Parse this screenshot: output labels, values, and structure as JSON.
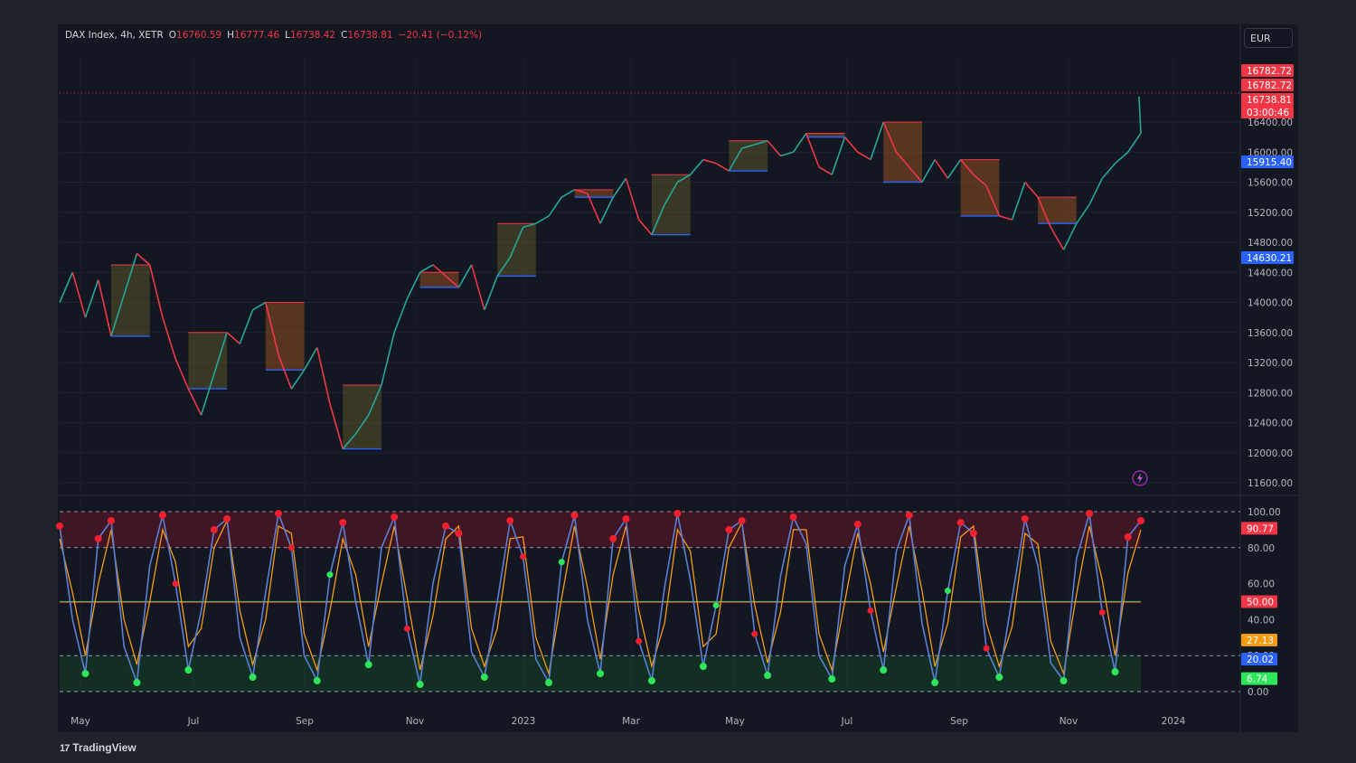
{
  "legend": {
    "symbol": "DAX Index, 4h, XETR",
    "o_label": "O",
    "o_value": "16760.59",
    "h_label": "H",
    "h_value": "16777.46",
    "l_label": "L",
    "l_value": "16738.42",
    "c_label": "C",
    "c_value": "16738.81",
    "change": "−20.41 (−0.12%)"
  },
  "currency": "EUR",
  "branding": "TradingView",
  "colors": {
    "up": "#26a69a",
    "down": "#f23645",
    "bg": "#131722",
    "stoch_k": "#5b7fd6",
    "stoch_d": "#f39c12",
    "green_dot": "#2ee65a",
    "red_dot": "#f0202f",
    "support": "#2962ff"
  },
  "chart_data": [
    {
      "type": "line",
      "name": "price",
      "x_ticks": [
        "May",
        "Jul",
        "Sep",
        "Nov",
        "2023",
        "Mar",
        "May",
        "Jul",
        "Sep",
        "Nov",
        "2024"
      ],
      "y_ticks": [
        "16400.00",
        "16000.00",
        "15600.00",
        "15200.00",
        "14800.00",
        "14400.00",
        "14000.00",
        "13600.00",
        "13200.00",
        "12800.00",
        "12400.00",
        "12000.00",
        "11600.00"
      ],
      "ylim": [
        11600,
        17200
      ],
      "x": [
        0,
        7,
        14,
        21,
        28,
        35,
        42,
        49,
        56,
        63,
        70,
        77,
        84,
        91,
        98,
        105,
        112,
        119,
        126,
        133,
        140,
        147,
        154,
        161,
        168,
        175,
        182,
        189,
        196,
        203,
        210,
        217,
        224,
        231,
        238,
        245,
        252,
        259,
        266,
        273,
        280,
        287,
        294,
        301,
        308,
        315,
        322,
        329,
        336,
        343,
        350,
        357,
        364,
        371,
        378,
        385,
        392,
        399,
        406,
        413,
        420,
        427,
        434,
        441,
        448,
        455,
        462,
        469,
        476,
        483,
        490,
        497,
        504,
        511,
        518,
        525,
        532,
        539,
        546,
        553,
        560,
        567,
        574,
        581,
        588
      ],
      "values": [
        14000,
        14400,
        13800,
        14300,
        13550,
        14100,
        14650,
        14500,
        13800,
        13250,
        12850,
        12500,
        13050,
        13600,
        13450,
        13900,
        14000,
        13300,
        12850,
        13100,
        13400,
        12650,
        12050,
        12250,
        12500,
        12900,
        13600,
        14050,
        14400,
        14500,
        14350,
        14200,
        14500,
        13900,
        14350,
        14600,
        15000,
        15050,
        15150,
        15400,
        15500,
        15450,
        15050,
        15400,
        15650,
        15100,
        14900,
        15300,
        15600,
        15700,
        15900,
        15850,
        15750,
        16050,
        16100,
        16150,
        15950,
        16000,
        16250,
        15800,
        15700,
        16200,
        16000,
        15900,
        16400,
        16000,
        15800,
        15600,
        15900,
        15650,
        15900,
        15700,
        15550,
        15150,
        15100,
        15600,
        15400,
        15000,
        14700,
        15050,
        15300,
        15650,
        15850,
        16000,
        16250
      ],
      "last_price": "16738.81",
      "countdown": "03:00:46",
      "high_tag": "16782.72",
      "high_tag_2": "16782.72",
      "resistance_tag": "15915.40",
      "support_tag": "14630.21"
    },
    {
      "type": "line",
      "name": "oscillator",
      "y_ticks": [
        "100.00",
        "80.00",
        "60.00",
        "40.00",
        "20.00",
        "0.00"
      ],
      "ylim": [
        0,
        100
      ],
      "overbought": 80,
      "oversold": 20,
      "midline": 50,
      "tags": [
        "90.77",
        "50.00",
        "27.13",
        "20.02",
        "6.74"
      ],
      "k_values": [
        92,
        40,
        10,
        85,
        95,
        25,
        5,
        70,
        98,
        60,
        12,
        45,
        90,
        96,
        30,
        8,
        55,
        99,
        80,
        20,
        6,
        65,
        94,
        50,
        15,
        80,
        97,
        35,
        4,
        60,
        92,
        88,
        22,
        8,
        50,
        95,
        75,
        18,
        5,
        72,
        98,
        40,
        10,
        85,
        96,
        28,
        6,
        58,
        99,
        62,
        14,
        48,
        90,
        95,
        32,
        9,
        64,
        97,
        82,
        20,
        7,
        70,
        93,
        45,
        12,
        78,
        98,
        38,
        5,
        56,
        94,
        88,
        24,
        8,
        52,
        96,
        70,
        16,
        6,
        74,
        99,
        44,
        11,
        86,
        95
      ],
      "d_values": [
        85,
        55,
        20,
        60,
        90,
        40,
        15,
        50,
        90,
        72,
        25,
        35,
        80,
        95,
        45,
        15,
        40,
        92,
        88,
        32,
        12,
        45,
        85,
        65,
        25,
        60,
        92,
        52,
        12,
        42,
        85,
        92,
        35,
        14,
        35,
        85,
        86,
        30,
        10,
        52,
        92,
        58,
        18,
        65,
        92,
        45,
        14,
        38,
        90,
        78,
        25,
        32,
        80,
        94,
        48,
        16,
        44,
        90,
        90,
        32,
        12,
        50,
        88,
        60,
        22,
        58,
        92,
        56,
        14,
        38,
        86,
        92,
        38,
        14,
        36,
        88,
        82,
        28,
        10,
        54,
        92,
        62,
        20,
        66,
        90
      ]
    }
  ]
}
